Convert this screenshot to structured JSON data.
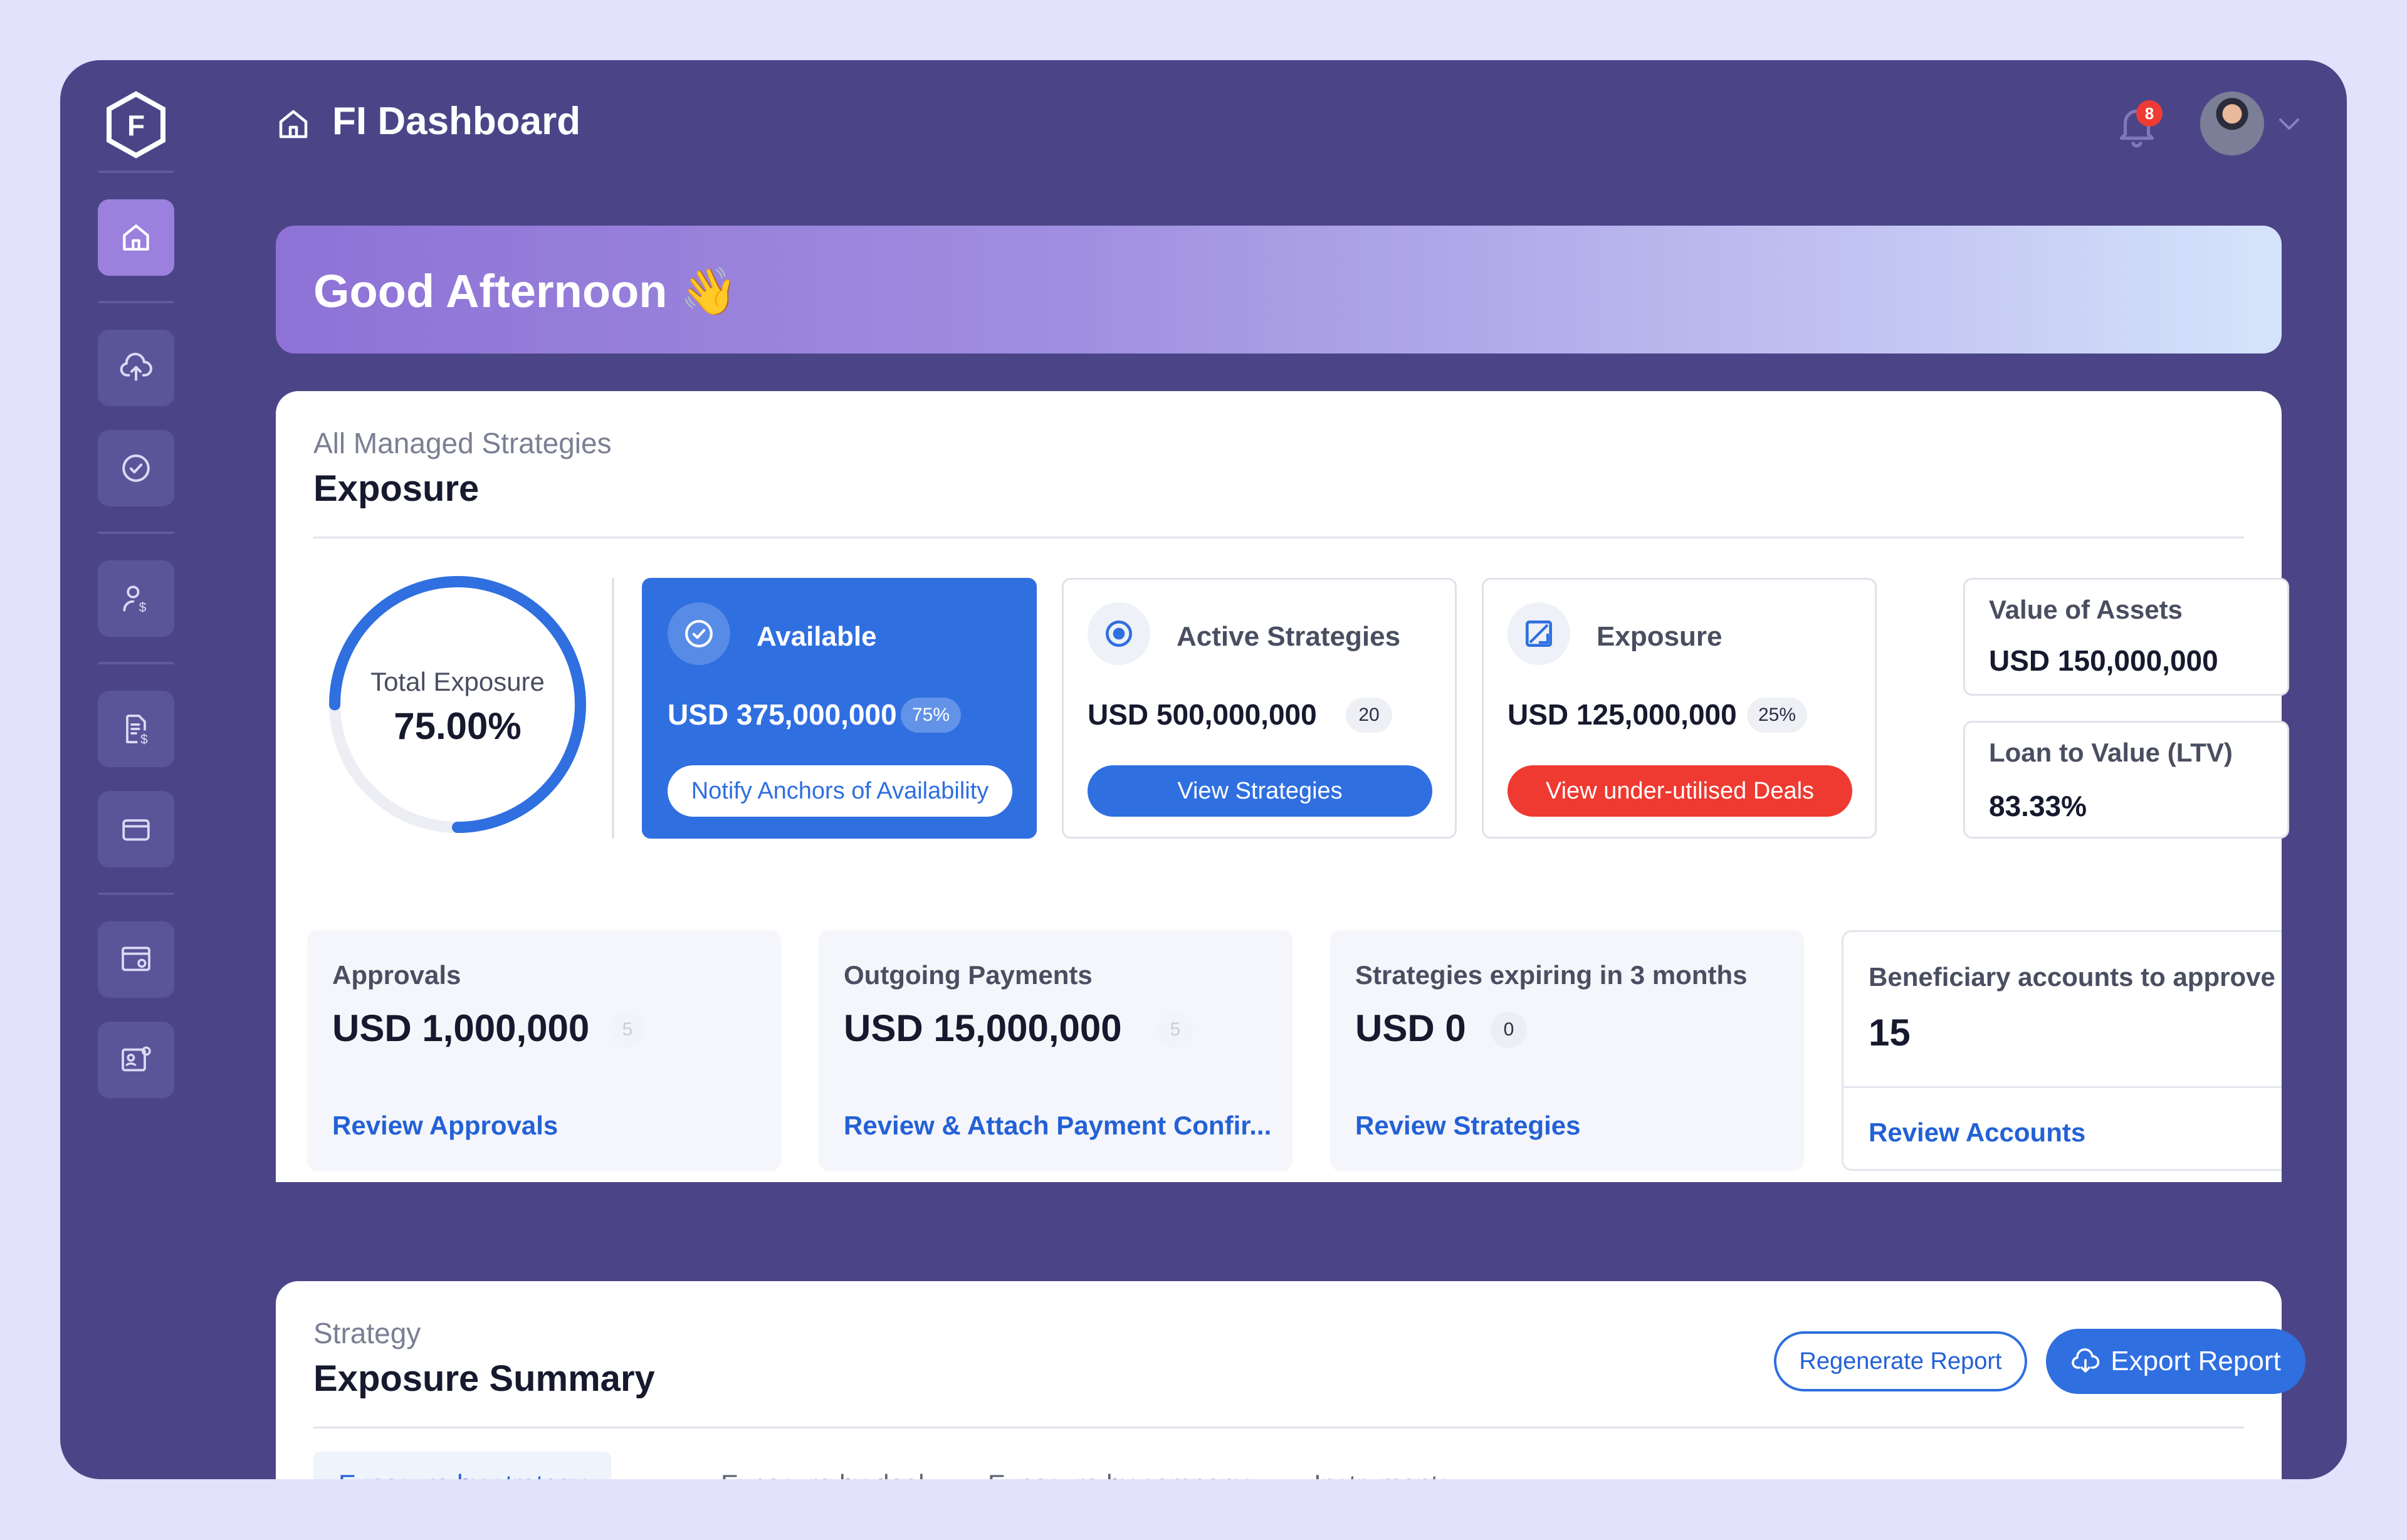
{
  "header": {
    "title": "FI Dashboard",
    "notification_count": "8"
  },
  "greeting": {
    "text": "Good Afternoon 👋"
  },
  "sidebar": {
    "logo_letter": "F",
    "items": [
      {
        "icon": "home-icon",
        "active": true
      },
      {
        "icon": "upload-cloud-icon"
      },
      {
        "icon": "check-circle-icon"
      },
      {
        "icon": "user-dollar-icon"
      },
      {
        "icon": "invoice-dollar-icon"
      },
      {
        "icon": "wallet-icon"
      },
      {
        "icon": "browser-settings-icon"
      },
      {
        "icon": "id-card-settings-icon"
      }
    ]
  },
  "exposure": {
    "subtitle": "All Managed Strategies",
    "title": "Exposure",
    "donut": {
      "label": "Total Exposure",
      "value": "75.00%",
      "fraction": 0.75
    },
    "tiles": [
      {
        "title": "Available",
        "amount": "USD 375,000,000",
        "pill": "75%",
        "button": "Notify Anchors of Availability"
      },
      {
        "title": "Active Strategies",
        "amount": "USD 500,000,000",
        "pill": "20",
        "button": "View Strategies"
      },
      {
        "title": "Exposure",
        "amount": "USD 125,000,000",
        "pill": "25%",
        "button": "View under-utilised Deals"
      }
    ],
    "small_tiles": [
      {
        "label": "Value of Assets",
        "value": "USD 150,000,000"
      },
      {
        "label": "Loan to Value (LTV)",
        "value": "83.33%"
      }
    ]
  },
  "kpis": [
    {
      "label": "Approvals",
      "value": "USD 1,000,000",
      "pill": "5",
      "link": "Review Approvals"
    },
    {
      "label": "Outgoing Payments",
      "value": "USD 15,000,000",
      "pill": "5",
      "link": "Review & Attach Payment Confir..."
    },
    {
      "label": "Strategies expiring in 3 months",
      "value": "USD 0",
      "pill": "0",
      "link": "Review Strategies"
    },
    {
      "label": "Beneficiary accounts to approve",
      "value": "15",
      "link": "Review Accounts"
    }
  ],
  "strategy": {
    "subtitle": "Strategy",
    "title": "Exposure Summary",
    "regenerate_label": "Regenerate Report",
    "export_label": "Export Report",
    "tabs": [
      "Exposure by strategy",
      "Exposure by deal",
      "Exposure by company",
      "Instruments"
    ]
  },
  "colors": {
    "accent": "#2f6fe0",
    "danger": "#ee3a31",
    "frame": "#4b4587"
  }
}
